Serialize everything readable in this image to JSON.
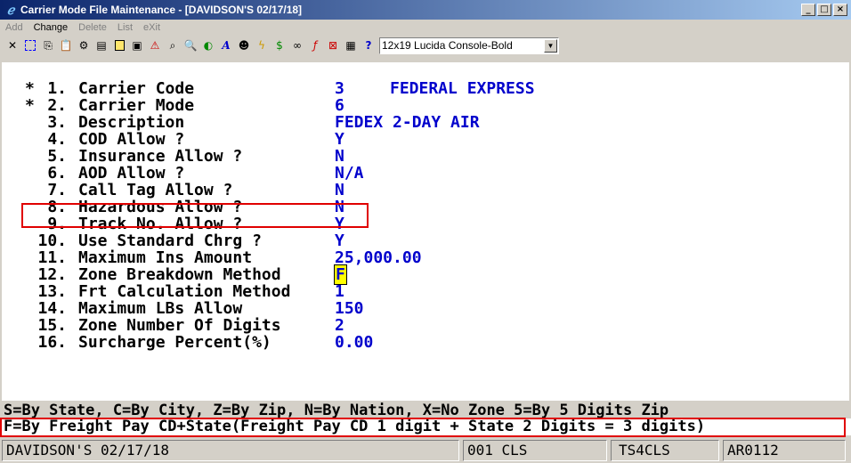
{
  "window": {
    "title": "Carrier Mode File Maintenance - [DAVIDSON'S 02/17/18]",
    "buttons": [
      "_",
      "□",
      "×"
    ]
  },
  "menu": [
    {
      "label": "Add",
      "enabled": false
    },
    {
      "label": "Change",
      "enabled": true
    },
    {
      "label": "Delete",
      "enabled": false
    },
    {
      "label": "List",
      "enabled": false
    },
    {
      "label": "eXit",
      "enabled": false
    }
  ],
  "toolbar": {
    "icons": [
      "close-icon",
      "select-icon",
      "copy-icon",
      "paste-icon",
      "settings-icon",
      "properties-icon",
      "note-icon",
      "print-icon",
      "alert-icon",
      "binoculars-icon",
      "search-icon",
      "color-icon",
      "font-icon",
      "person-icon",
      "lightning-icon",
      "currency-icon",
      "link-icon",
      "function-icon",
      "cancel-icon",
      "report-icon",
      "help-icon"
    ],
    "font_select": "12x19 Lucida Console-Bold"
  },
  "fields": [
    {
      "star": "*",
      "num": "1.",
      "label": "Carrier Code",
      "value": "3",
      "desc": "FEDERAL EXPRESS"
    },
    {
      "star": "*",
      "num": "2.",
      "label": "Carrier Mode",
      "value": "6",
      "desc": ""
    },
    {
      "star": "",
      "num": "3.",
      "label": "Description",
      "value": "FEDEX 2-DAY AIR",
      "desc": ""
    },
    {
      "star": "",
      "num": "4.",
      "label": "COD Allow ?",
      "value": "Y",
      "desc": ""
    },
    {
      "star": "",
      "num": "5.",
      "label": "Insurance Allow ?",
      "value": "N",
      "desc": ""
    },
    {
      "star": "",
      "num": "6.",
      "label": "AOD Allow ?",
      "value": "N/A",
      "desc": ""
    },
    {
      "star": "",
      "num": "7.",
      "label": "Call Tag Allow ?",
      "value": "N",
      "desc": ""
    },
    {
      "star": "",
      "num": "8.",
      "label": "Hazardous Allow ?",
      "value": "N",
      "desc": ""
    },
    {
      "star": "",
      "num": "9.",
      "label": "Track No. Allow ?",
      "value": "Y",
      "desc": ""
    },
    {
      "star": "",
      "num": "10.",
      "label": "Use Standard Chrg ?",
      "value": "Y",
      "desc": ""
    },
    {
      "star": "",
      "num": "11.",
      "label": "Maximum Ins Amount",
      "value": "25,000.00",
      "desc": ""
    },
    {
      "star": "",
      "num": "12.",
      "label": "Zone Breakdown Method",
      "value": "F",
      "desc": ""
    },
    {
      "star": "",
      "num": "13.",
      "label": "Frt Calculation Method",
      "value": "1",
      "desc": ""
    },
    {
      "star": "",
      "num": "14.",
      "label": "Maximum LBs Allow",
      "value": "150",
      "desc": ""
    },
    {
      "star": "",
      "num": "15.",
      "label": "Zone Number Of Digits",
      "value": "2",
      "desc": ""
    },
    {
      "star": "",
      "num": "16.",
      "label": "Surcharge Percent(%)",
      "value": "0.00",
      "desc": ""
    }
  ],
  "help": {
    "line1": "S=By State, C=By City, Z=By Zip, N=By Nation, X=No Zone 5=By 5 Digits Zip",
    "line2": "F=By Freight Pay CD+State(Freight Pay CD 1 digit + State 2 Digits = 3 digits)"
  },
  "status": {
    "company": "DAVIDSON'S 02/17/18",
    "code": "001 CLS",
    "terminal": "TS4CLS",
    "program": "AR0112"
  }
}
